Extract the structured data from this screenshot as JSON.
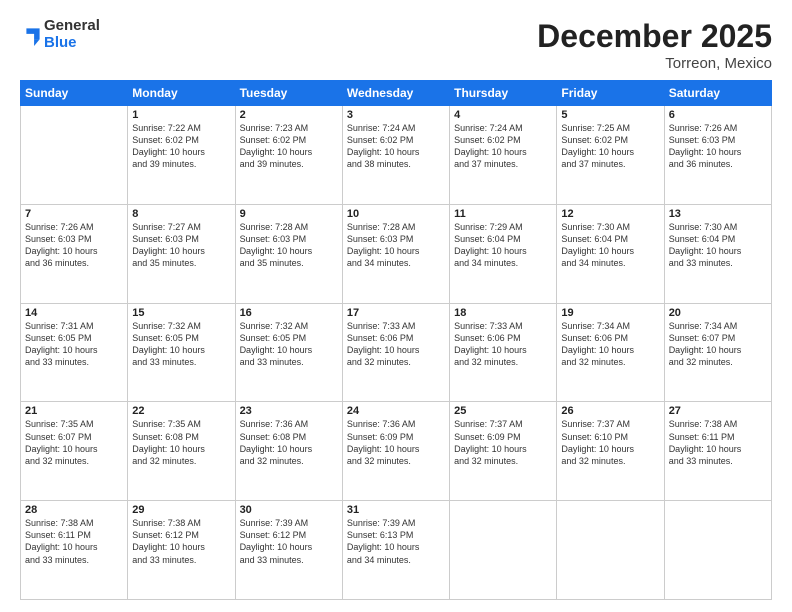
{
  "app": {
    "logo_general": "General",
    "logo_blue": "Blue",
    "title": "December 2025",
    "subtitle": "Torreon, Mexico"
  },
  "calendar": {
    "days": [
      "Sunday",
      "Monday",
      "Tuesday",
      "Wednesday",
      "Thursday",
      "Friday",
      "Saturday"
    ],
    "weeks": [
      [
        {
          "day": "",
          "text": ""
        },
        {
          "day": "1",
          "text": "Sunrise: 7:22 AM\nSunset: 6:02 PM\nDaylight: 10 hours\nand 39 minutes."
        },
        {
          "day": "2",
          "text": "Sunrise: 7:23 AM\nSunset: 6:02 PM\nDaylight: 10 hours\nand 39 minutes."
        },
        {
          "day": "3",
          "text": "Sunrise: 7:24 AM\nSunset: 6:02 PM\nDaylight: 10 hours\nand 38 minutes."
        },
        {
          "day": "4",
          "text": "Sunrise: 7:24 AM\nSunset: 6:02 PM\nDaylight: 10 hours\nand 37 minutes."
        },
        {
          "day": "5",
          "text": "Sunrise: 7:25 AM\nSunset: 6:02 PM\nDaylight: 10 hours\nand 37 minutes."
        },
        {
          "day": "6",
          "text": "Sunrise: 7:26 AM\nSunset: 6:03 PM\nDaylight: 10 hours\nand 36 minutes."
        }
      ],
      [
        {
          "day": "7",
          "text": "Sunrise: 7:26 AM\nSunset: 6:03 PM\nDaylight: 10 hours\nand 36 minutes."
        },
        {
          "day": "8",
          "text": "Sunrise: 7:27 AM\nSunset: 6:03 PM\nDaylight: 10 hours\nand 35 minutes."
        },
        {
          "day": "9",
          "text": "Sunrise: 7:28 AM\nSunset: 6:03 PM\nDaylight: 10 hours\nand 35 minutes."
        },
        {
          "day": "10",
          "text": "Sunrise: 7:28 AM\nSunset: 6:03 PM\nDaylight: 10 hours\nand 34 minutes."
        },
        {
          "day": "11",
          "text": "Sunrise: 7:29 AM\nSunset: 6:04 PM\nDaylight: 10 hours\nand 34 minutes."
        },
        {
          "day": "12",
          "text": "Sunrise: 7:30 AM\nSunset: 6:04 PM\nDaylight: 10 hours\nand 34 minutes."
        },
        {
          "day": "13",
          "text": "Sunrise: 7:30 AM\nSunset: 6:04 PM\nDaylight: 10 hours\nand 33 minutes."
        }
      ],
      [
        {
          "day": "14",
          "text": "Sunrise: 7:31 AM\nSunset: 6:05 PM\nDaylight: 10 hours\nand 33 minutes."
        },
        {
          "day": "15",
          "text": "Sunrise: 7:32 AM\nSunset: 6:05 PM\nDaylight: 10 hours\nand 33 minutes."
        },
        {
          "day": "16",
          "text": "Sunrise: 7:32 AM\nSunset: 6:05 PM\nDaylight: 10 hours\nand 33 minutes."
        },
        {
          "day": "17",
          "text": "Sunrise: 7:33 AM\nSunset: 6:06 PM\nDaylight: 10 hours\nand 32 minutes."
        },
        {
          "day": "18",
          "text": "Sunrise: 7:33 AM\nSunset: 6:06 PM\nDaylight: 10 hours\nand 32 minutes."
        },
        {
          "day": "19",
          "text": "Sunrise: 7:34 AM\nSunset: 6:06 PM\nDaylight: 10 hours\nand 32 minutes."
        },
        {
          "day": "20",
          "text": "Sunrise: 7:34 AM\nSunset: 6:07 PM\nDaylight: 10 hours\nand 32 minutes."
        }
      ],
      [
        {
          "day": "21",
          "text": "Sunrise: 7:35 AM\nSunset: 6:07 PM\nDaylight: 10 hours\nand 32 minutes."
        },
        {
          "day": "22",
          "text": "Sunrise: 7:35 AM\nSunset: 6:08 PM\nDaylight: 10 hours\nand 32 minutes."
        },
        {
          "day": "23",
          "text": "Sunrise: 7:36 AM\nSunset: 6:08 PM\nDaylight: 10 hours\nand 32 minutes."
        },
        {
          "day": "24",
          "text": "Sunrise: 7:36 AM\nSunset: 6:09 PM\nDaylight: 10 hours\nand 32 minutes."
        },
        {
          "day": "25",
          "text": "Sunrise: 7:37 AM\nSunset: 6:09 PM\nDaylight: 10 hours\nand 32 minutes."
        },
        {
          "day": "26",
          "text": "Sunrise: 7:37 AM\nSunset: 6:10 PM\nDaylight: 10 hours\nand 32 minutes."
        },
        {
          "day": "27",
          "text": "Sunrise: 7:38 AM\nSunset: 6:11 PM\nDaylight: 10 hours\nand 33 minutes."
        }
      ],
      [
        {
          "day": "28",
          "text": "Sunrise: 7:38 AM\nSunset: 6:11 PM\nDaylight: 10 hours\nand 33 minutes."
        },
        {
          "day": "29",
          "text": "Sunrise: 7:38 AM\nSunset: 6:12 PM\nDaylight: 10 hours\nand 33 minutes."
        },
        {
          "day": "30",
          "text": "Sunrise: 7:39 AM\nSunset: 6:12 PM\nDaylight: 10 hours\nand 33 minutes."
        },
        {
          "day": "31",
          "text": "Sunrise: 7:39 AM\nSunset: 6:13 PM\nDaylight: 10 hours\nand 34 minutes."
        },
        {
          "day": "",
          "text": ""
        },
        {
          "day": "",
          "text": ""
        },
        {
          "day": "",
          "text": ""
        }
      ]
    ]
  }
}
